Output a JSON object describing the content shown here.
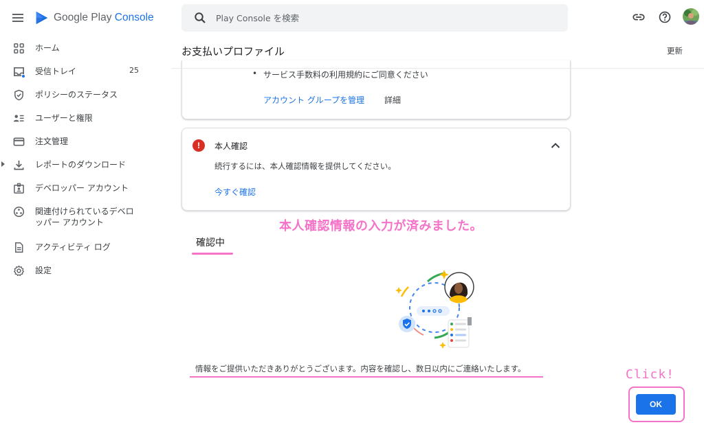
{
  "app": {
    "brand_primary": "Google Play",
    "brand_accent": "Console",
    "accent_color": "#1a73e8",
    "annotation_color": "#f572c9"
  },
  "sidebar": {
    "items": [
      {
        "label": "ホーム",
        "icon": "dashboard-icon"
      },
      {
        "label": "受信トレイ",
        "icon": "inbox-icon",
        "count": "25"
      },
      {
        "label": "ポリシーのステータス",
        "icon": "shield-check-icon"
      },
      {
        "label": "ユーザーと権限",
        "icon": "users-permissions-icon"
      },
      {
        "label": "注文管理",
        "icon": "credit-card-icon"
      },
      {
        "label": "レポートのダウンロード",
        "icon": "download-icon"
      },
      {
        "label": "デベロッパー アカウント",
        "icon": "developer-badge-icon"
      },
      {
        "label": "関連付けられているデベロッパー アカウント",
        "icon": "linked-accounts-icon"
      },
      {
        "label": "アクティビティ ログ",
        "icon": "document-log-icon"
      },
      {
        "label": "設定",
        "icon": "gear-icon"
      }
    ]
  },
  "header": {
    "search_placeholder": "Play Console を検索",
    "page_title": "お支払いプロファイル",
    "refresh_label": "更新"
  },
  "card_terms": {
    "bullet": "サービス手数料の利用規約にご同意ください",
    "manage_link": "アカウント グループを管理",
    "detail_link": "詳細"
  },
  "card_identity": {
    "title": "本人確認",
    "description": "続行するには、本人確認情報を提供してください。",
    "verify_link": "今すぐ確認"
  },
  "annotations": {
    "note": "本人確認情報の入力が済みました。",
    "click": "Click!"
  },
  "status_tab": {
    "label": "確認中"
  },
  "message": {
    "thanks": "情報をご提供いただきありがとうございます。内容を確認し、数日以内にご連絡いたします。"
  },
  "actions": {
    "ok_label": "OK"
  }
}
